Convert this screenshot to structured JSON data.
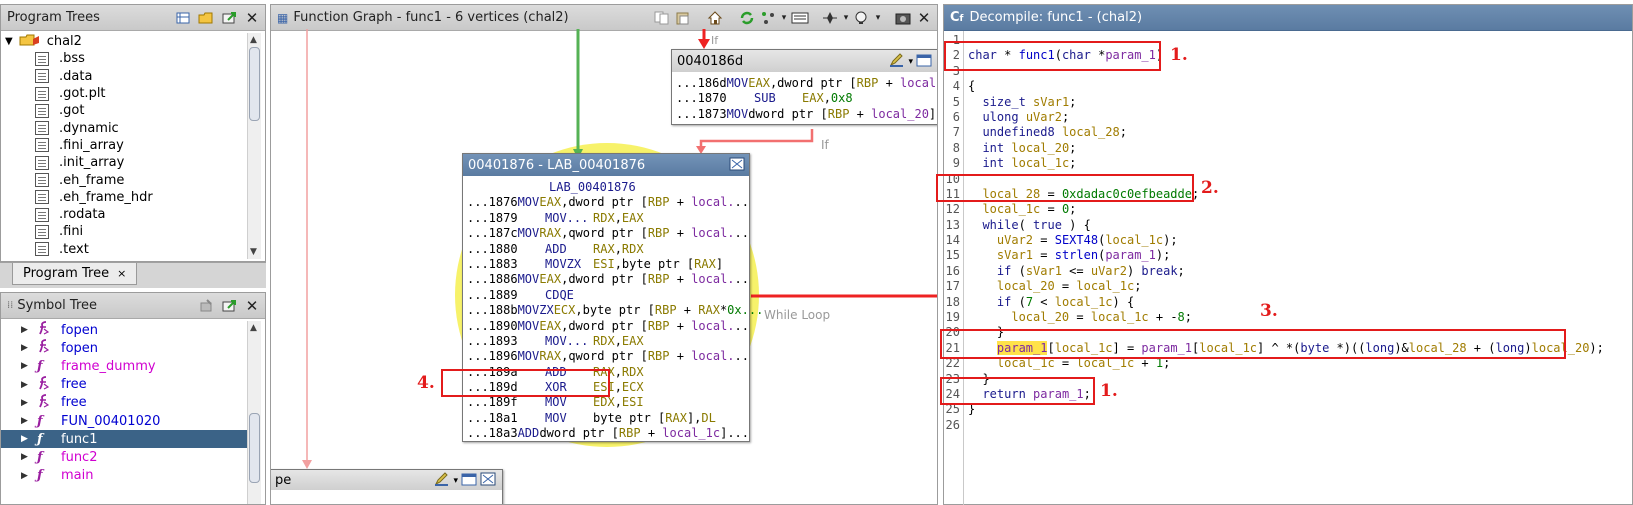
{
  "program_trees": {
    "title": "Program Trees",
    "root": "chal2",
    "sections": [
      ".bss",
      ".data",
      ".got.plt",
      ".got",
      ".dynamic",
      ".fini_array",
      ".init_array",
      ".eh_frame",
      ".eh_frame_hdr",
      ".rodata",
      ".fini",
      ".text"
    ],
    "tab_label": "Program Tree",
    "tab_close": "×"
  },
  "symbol_tree": {
    "title": "Symbol Tree",
    "items": [
      {
        "name": "fopen",
        "kind": "external",
        "color": "#0000d0"
      },
      {
        "name": "fopen",
        "kind": "external",
        "color": "#0000d0"
      },
      {
        "name": "frame_dummy",
        "kind": "function",
        "color": "#d000d0"
      },
      {
        "name": "free",
        "kind": "external",
        "color": "#0000d0"
      },
      {
        "name": "free",
        "kind": "external",
        "color": "#0000d0"
      },
      {
        "name": "FUN_00401020",
        "kind": "function",
        "color": "#0000d0"
      },
      {
        "name": "func1",
        "kind": "function",
        "color": "#ffffff",
        "selected": true
      },
      {
        "name": "func2",
        "kind": "function",
        "color": "#d000d0"
      },
      {
        "name": "main",
        "kind": "function",
        "color": "#d000d0"
      }
    ]
  },
  "function_graph": {
    "title": "Function Graph - func1 - 6 vertices  (chal2)",
    "edge_label_if_top": "If",
    "edge_label_if": "If",
    "loop_label": "While Loop",
    "bottom_block_title": "pe",
    "top_block": {
      "title": "0040186d",
      "rows": [
        {
          "addr": "...186d",
          "mn": "MOV",
          "ops": "EAX,dword ptr [RBP + local."
        },
        {
          "addr": "...1870",
          "mn": "SUB",
          "ops": "EAX,0x8"
        },
        {
          "addr": "...1873",
          "mn": "MOV",
          "ops": "dword ptr [RBP + local_20]."
        }
      ]
    },
    "main_block": {
      "title": "00401876 - LAB_00401876",
      "label": "LAB_00401876",
      "rows": [
        {
          "addr": "...1876",
          "mn": "MOV",
          "ops": "EAX,dword ptr [RBP + local..."
        },
        {
          "addr": "...1879",
          "mn": "MOV...",
          "ops": "RDX,EAX"
        },
        {
          "addr": "...187c",
          "mn": "MOV",
          "ops": "RAX,qword ptr [RBP + local..."
        },
        {
          "addr": "...1880",
          "mn": "ADD",
          "ops": "RAX,RDX"
        },
        {
          "addr": "...1883",
          "mn": "MOVZX",
          "ops": "ESI,byte ptr [RAX]"
        },
        {
          "addr": "...1886",
          "mn": "MOV",
          "ops": "EAX,dword ptr [RBP + local..."
        },
        {
          "addr": "...1889",
          "mn": "CDQE",
          "ops": ""
        },
        {
          "addr": "...188b",
          "mn": "MOVZX",
          "ops": "ECX,byte ptr [RBP + RAX*0x..."
        },
        {
          "addr": "...1890",
          "mn": "MOV",
          "ops": "EAX,dword ptr [RBP + local..."
        },
        {
          "addr": "...1893",
          "mn": "MOV...",
          "ops": "RDX,EAX"
        },
        {
          "addr": "...1896",
          "mn": "MOV",
          "ops": "RAX,qword ptr [RBP + local..."
        },
        {
          "addr": "...189a",
          "mn": "ADD",
          "ops": "RAX,RDX"
        },
        {
          "addr": "...189d",
          "mn": "XOR",
          "ops": "ESI,ECX"
        },
        {
          "addr": "...189f",
          "mn": "MOV",
          "ops": "EDX,ESI"
        },
        {
          "addr": "...18a1",
          "mn": "MOV",
          "ops": "byte ptr [RAX],DL"
        },
        {
          "addr": "...18a3",
          "mn": "ADD",
          "ops": "dword ptr [RBP + local_1c]..."
        }
      ]
    }
  },
  "decompile": {
    "title": "Decompile: func1 - (chal2)",
    "lines": [
      "",
      "char * func1(char *param_1)",
      "",
      "{",
      "  size_t sVar1;",
      "  ulong uVar2;",
      "  undefined8 local_28;",
      "  int local_20;",
      "  int local_1c;",
      "",
      "  local_28 = 0xdadac0c0efbeadde;",
      "  local_1c = 0;",
      "  while( true ) {",
      "    uVar2 = SEXT48(local_1c);",
      "    sVar1 = strlen(param_1);",
      "    if (sVar1 <= uVar2) break;",
      "    local_20 = local_1c;",
      "    if (7 < local_1c) {",
      "      local_20 = local_1c + -8;",
      "    }",
      "    param_1[local_1c] = param_1[local_1c] ^ *(byte *)((long)&local_28 + (long)local_20);",
      "    local_1c = local_1c + 1;",
      "  }",
      "  return param_1;",
      "}",
      ""
    ]
  },
  "annotations": [
    "1.",
    "2.",
    "3.",
    "1.",
    "4."
  ],
  "colors": {
    "annotation_red": "#e31b1b",
    "selection_blue": "#3b6387",
    "loop_highlight": "#f7f26a",
    "edge_green": "#55b255",
    "edge_red": "#ee2222"
  }
}
